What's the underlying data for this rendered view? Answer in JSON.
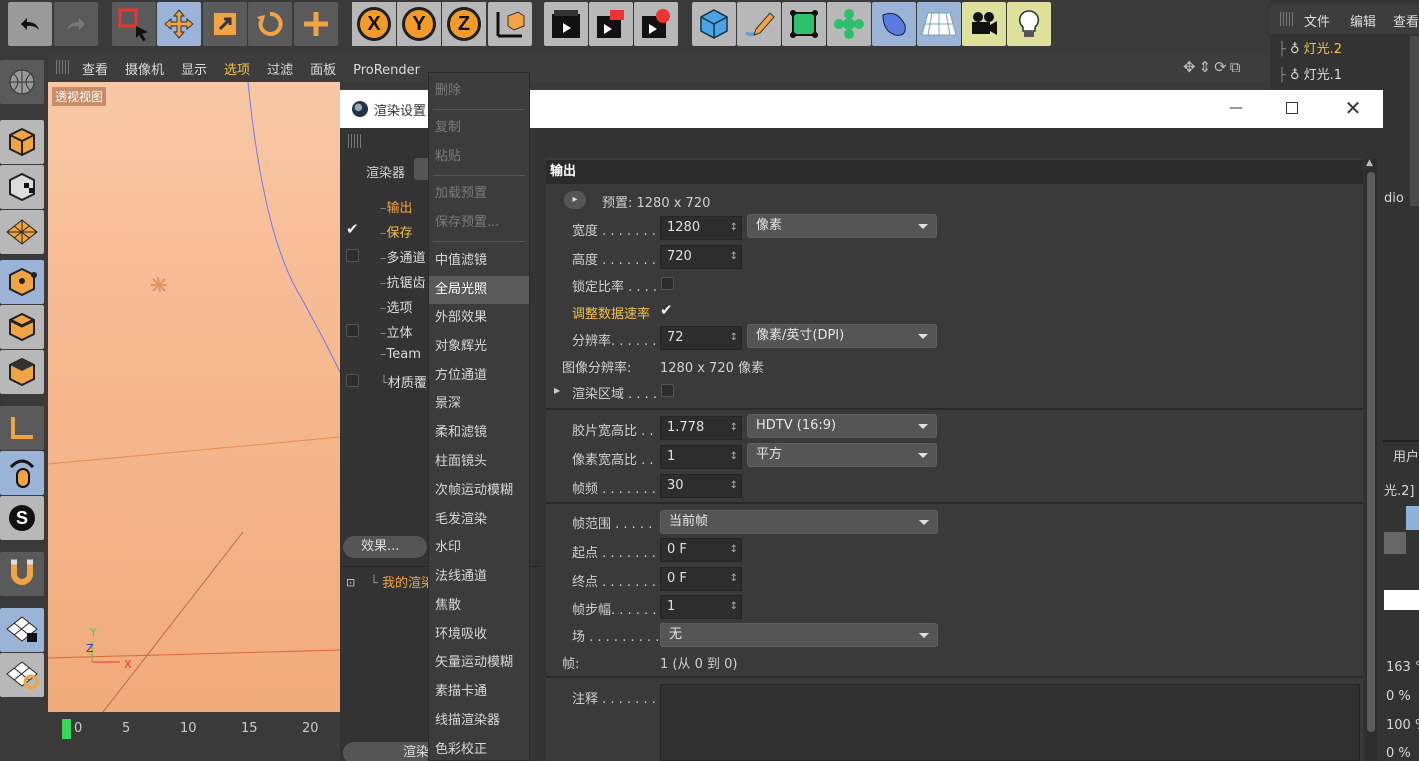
{
  "toolbar": {
    "icons": [
      "undo-icon",
      "redo-icon",
      "live-selection-icon",
      "move-icon",
      "scale-icon",
      "rotate-icon",
      "add-icon",
      "x-axis-lock-icon",
      "y-axis-lock-icon",
      "z-axis-lock-icon",
      "world-coordinates-icon",
      "render-view-icon",
      "render-picture-viewer-icon",
      "render-settings-icon",
      "cube-object-icon",
      "pen-spline-icon",
      "subdivision-icon",
      "cloner-icon",
      "deformer-icon",
      "floor-icon",
      "camera-icon",
      "light-icon"
    ],
    "axis_labels": [
      "X",
      "Y",
      "Z"
    ]
  },
  "viewport": {
    "menu": [
      "查看",
      "摄像机",
      "显示",
      "选项",
      "过滤",
      "面板",
      "ProRender"
    ],
    "label": "透视视图",
    "axes": {
      "x": "X",
      "y": "Y",
      "z": "Z"
    }
  },
  "timeline": {
    "ticks": [
      "0",
      "5",
      "10",
      "15",
      "20"
    ]
  },
  "objects_panel": {
    "menu": [
      "文件",
      "编辑",
      "查看"
    ],
    "items": [
      "灯光.2",
      "灯光.1"
    ],
    "fragments": [
      "dio",
      "用户",
      "光.2]",
      "163 °",
      "0 %",
      "100 %",
      "0 %"
    ]
  },
  "render_settings": {
    "title": "渲染设置",
    "renderer_label": "渲染器",
    "tree": [
      "输出",
      "保存",
      "多通道",
      "抗锯齿",
      "选项",
      "立体",
      "Team",
      "材质覆写"
    ],
    "tree_checks": [
      false,
      true,
      false,
      false,
      false,
      false,
      false,
      false
    ],
    "effects_button": "效果...",
    "my_render_setting": "我的渲染设置",
    "bottom_button": "渲染",
    "output": {
      "header": "输出",
      "preset": "预置: 1280 x 720",
      "width_label": "宽度 . . . . . . .",
      "width": "1280",
      "unit": "像素",
      "height_label": "高度 . . . . . . .",
      "height": "720",
      "lock_ratio_label": "锁定比率 . . . .",
      "adjust_rate_label": "调整数据速率",
      "resolution_label": "分辨率. . . . . .",
      "resolution": "72",
      "resolution_unit": "像素/英寸(DPI)",
      "image_res_label": "图像分辨率:",
      "image_res": "1280 x 720 像素",
      "render_region_label": "渲染区域 . . . .",
      "film_aspect_label": "胶片宽高比 . .",
      "film_aspect": "1.778",
      "film_aspect_preset": "HDTV (16:9)",
      "pixel_aspect_label": "像素宽高比 . .",
      "pixel_aspect": "1",
      "pixel_aspect_preset": "平方",
      "fps_label": "帧频 . . . . . . .",
      "fps": "30",
      "frame_range_label": "帧范围 . . . . .",
      "frame_range": "当前帧",
      "start_label": "起点 . . . . . . .",
      "start": "0 F",
      "end_label": "终点 . . . . . . .",
      "end": "0 F",
      "step_label": "帧步幅. . . . . .",
      "step": "1",
      "field_label": "场 . . . . . . . . .",
      "field": "无",
      "frames_label": "帧:",
      "frames": "1 (从 0 到 0)",
      "notes_label": "注释 . . . . . . ."
    }
  },
  "context_menu": {
    "items": [
      {
        "label": "删除",
        "disabled": true
      },
      {
        "label": "复制",
        "disabled": true
      },
      {
        "label": "粘贴",
        "disabled": true
      },
      {
        "label": "加载预置",
        "disabled": true
      },
      {
        "label": "保存预置...",
        "disabled": true
      },
      {
        "label": "中值滤镜",
        "disabled": false
      },
      {
        "label": "全局光照",
        "disabled": false,
        "active": true
      },
      {
        "label": "外部效果",
        "disabled": false
      },
      {
        "label": "对象辉光",
        "disabled": false
      },
      {
        "label": "方位通道",
        "disabled": false
      },
      {
        "label": "景深",
        "disabled": false
      },
      {
        "label": "柔和滤镜",
        "disabled": false
      },
      {
        "label": "柱面镜头",
        "disabled": false
      },
      {
        "label": "次帧运动模糊",
        "disabled": false
      },
      {
        "label": "毛发渲染",
        "disabled": false
      },
      {
        "label": "水印",
        "disabled": false
      },
      {
        "label": "法线通道",
        "disabled": false
      },
      {
        "label": "焦散",
        "disabled": false
      },
      {
        "label": "环境吸收",
        "disabled": false
      },
      {
        "label": "矢量运动模糊",
        "disabled": false
      },
      {
        "label": "素描卡通",
        "disabled": false
      },
      {
        "label": "线描渲染器",
        "disabled": false
      },
      {
        "label": "色彩校正",
        "disabled": false
      }
    ]
  },
  "colors": {
    "accent": "#f2a444",
    "highlight": "#9ab3d6",
    "selected_text": "#f2c14e"
  }
}
